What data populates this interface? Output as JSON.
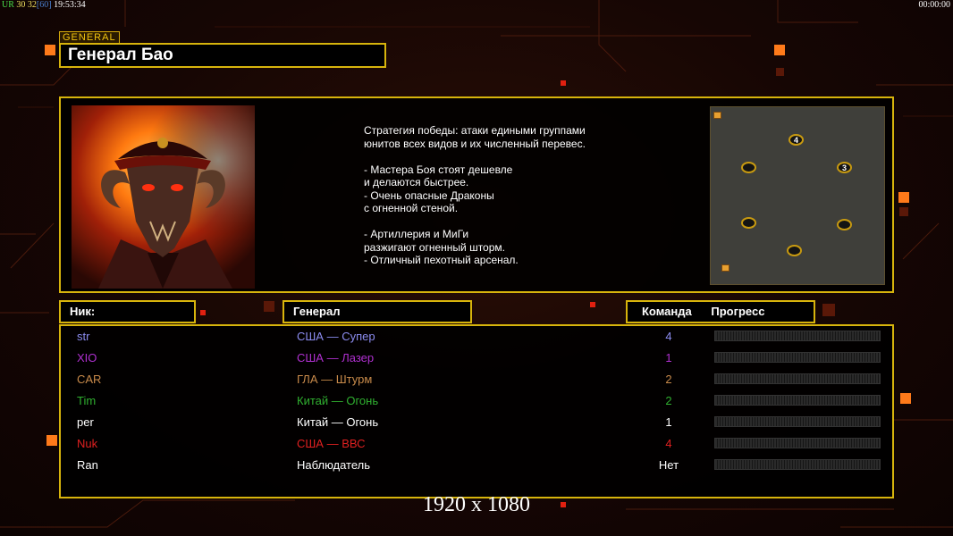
{
  "hud": {
    "ur_label": "UR",
    "fps": "30",
    "fps_target": "32",
    "fps_max": "[60]",
    "clock": "19:53:34",
    "timer": "00:00:00"
  },
  "general": {
    "tag": "GENERAL",
    "name": "Генерал Бао",
    "strategy_lines": [
      "Стратегия победы: атаки едиными группами",
      "юнитов всех видов и их численный перевес.",
      "",
      "- Мастера Боя стоят дешевле",
      "и делаются быстрее.",
      "- Очень опасные Драконы",
      "с огненной стеной.",
      "",
      "- Артиллерия и МиГи",
      "разжигают огненный шторм.",
      "- Отличный пехотный арсенал."
    ],
    "minimap_spawn_labels": [
      "4",
      "",
      "3",
      "",
      "",
      ""
    ]
  },
  "columns": {
    "nick": "Ник:",
    "general": "Генерал",
    "team": "Команда",
    "progress": "Прогресс"
  },
  "players": [
    {
      "nick": "str",
      "general": "США — Супер",
      "team": "4",
      "color": "#8c8cf0"
    },
    {
      "nick": "XIO",
      "general": "США — Лазер",
      "team": "1",
      "color": "#b030d0"
    },
    {
      "nick": "CAR",
      "general": "ГЛА — Штурм",
      "team": "2",
      "color": "#c88a4a"
    },
    {
      "nick": "Tim",
      "general": "Китай — Огонь",
      "team": "2",
      "color": "#30b030"
    },
    {
      "nick": "per",
      "general": "Китай — Огонь",
      "team": "1",
      "color": "#ffffff"
    },
    {
      "nick": "Nuk",
      "general": "США — ВВС",
      "team": "4",
      "color": "#e02020"
    },
    {
      "nick": "Ran",
      "general": "Наблюдатель",
      "team": "Нет",
      "color": "#ffffff"
    }
  ],
  "colors": {
    "frame": "#d7b40c",
    "accent": "#ff7a1a"
  },
  "watermark": "1920 x 1080"
}
